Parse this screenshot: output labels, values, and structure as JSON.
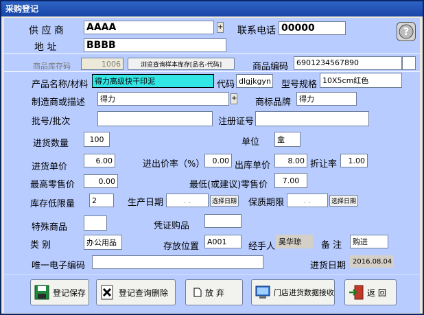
{
  "window": {
    "title": "采购登记"
  },
  "fields": {
    "supplier": {
      "label": "供 应 商",
      "value": "AAAA"
    },
    "phone": {
      "label": "联系电话",
      "value": "00000"
    },
    "address": {
      "label": "地  址",
      "value": "BBBB"
    },
    "stock_code": {
      "label": "商品库存码",
      "value": "1006"
    },
    "browse_button": "浏览查询样本库存[品名-代码]",
    "product_code": {
      "label": "商品编码",
      "value": "6901234567890"
    },
    "product_name": {
      "label": "产品名称/材料",
      "value": "得力高级快干印泥"
    },
    "code": {
      "label": "代码",
      "value": "dlgjkgyn"
    },
    "spec": {
      "label": "型号规格",
      "value": "10X5cm红色"
    },
    "maker": {
      "label": "制造商或描述",
      "value": "得力"
    },
    "brand": {
      "label": "商标品牌",
      "value": "得力"
    },
    "batch": {
      "label": "批号/批次",
      "value": ""
    },
    "reg_no": {
      "label": "注册证号",
      "value": ""
    },
    "qty": {
      "label": "进货数量",
      "value": "100"
    },
    "unit": {
      "label": "单位",
      "value": "盒"
    },
    "price": {
      "label": "进货单价",
      "value": "6.00"
    },
    "rate": {
      "label": "进出价率（%）",
      "value": "0.00"
    },
    "out_price": {
      "label": "出库单价",
      "value": "8.00"
    },
    "discount": {
      "label": "折让率",
      "value": "1.00"
    },
    "max_retail": {
      "label": "最高零售价",
      "value": "0.00"
    },
    "min_retail": {
      "label": "最低(或建议)零售价",
      "value": "7.00"
    },
    "stock_min": {
      "label": "库存低限量",
      "value": "2"
    },
    "prod_date": {
      "label": "生产日期",
      "value": ". .",
      "button": "选择日期"
    },
    "expiry": {
      "label": "保质期限",
      "value": ". .",
      "button": "选择日期"
    },
    "special": {
      "label": "特殊商品",
      "value": ""
    },
    "voucher": {
      "label": "凭证购品",
      "value": ""
    },
    "category": {
      "label": "类  别",
      "value": "办公用品"
    },
    "location": {
      "label": "存放位置",
      "value": "A001"
    },
    "handler": {
      "label": "经手人",
      "value": "吴华琼"
    },
    "remark": {
      "label": "备  注",
      "value": "购进"
    },
    "ecode": {
      "label": "唯一电子编码",
      "value": ""
    },
    "purchase_date": {
      "label": "进货日期",
      "value": "2016.08.04"
    }
  },
  "toolbar": {
    "save": "登记保存",
    "query_delete": "登记查询删除",
    "abandon": "放 弃",
    "store_receive": "门店进货数据接收",
    "back": "返 回"
  },
  "dropdown_arrow": "+"
}
